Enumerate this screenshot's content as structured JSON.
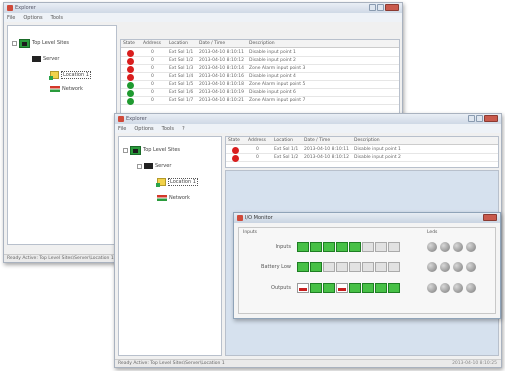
{
  "colors": {
    "status_red": "#d91e1e",
    "status_green": "#1f9a30",
    "io_on": "#47c046",
    "io_fault": "#c81e1e",
    "title_bar": "#cfd9e6",
    "workspace": "#d6e1ee"
  },
  "back_window": {
    "title": "Explorer",
    "menu": [
      "File",
      "Options",
      "Tools"
    ],
    "tree": {
      "root": "Top Level Sites",
      "server": "Server",
      "folder": "Location 1",
      "network": "Network"
    },
    "columns": [
      "State",
      "Address",
      "Location",
      "Date / Time",
      "Description"
    ],
    "rows": [
      {
        "status": "red",
        "address": "0",
        "location": "Ext Sol 1/1",
        "datetime": "2013-04-10 8:10:11",
        "description": "Disable input point 1"
      },
      {
        "status": "red",
        "address": "0",
        "location": "Ext Sol 1/2",
        "datetime": "2013-04-10 8:10:12",
        "description": "Disable input point 2"
      },
      {
        "status": "red",
        "address": "0",
        "location": "Ext Sol 1/3",
        "datetime": "2013-04-10 8:10:14",
        "description": "Zone Alarm input point 3"
      },
      {
        "status": "red",
        "address": "0",
        "location": "Ext Sol 1/4",
        "datetime": "2013-04-10 8:10:16",
        "description": "Disable input point 4"
      },
      {
        "status": "green",
        "address": "0",
        "location": "Ext Sol 1/5",
        "datetime": "2013-04-10 8:10:18",
        "description": "Zone Alarm input point 5"
      },
      {
        "status": "green",
        "address": "0",
        "location": "Ext Sol 1/6",
        "datetime": "2013-04-10 8:10:19",
        "description": "Disable input point 6"
      },
      {
        "status": "green",
        "address": "0",
        "location": "Ext Sol 1/7",
        "datetime": "2013-04-10 8:10:21",
        "description": "Zone Alarm input point 7"
      }
    ],
    "status_text": "Ready Active: Top Level Sites\\Server\\Location 1"
  },
  "front_window": {
    "title": "Explorer",
    "menu": [
      "File",
      "Options",
      "Tools",
      "?"
    ],
    "tree": {
      "root": "Top Level Sites",
      "server": "Server",
      "folder": "Location 1",
      "network": "Network"
    },
    "columns": [
      "State",
      "Address",
      "Location",
      "Date / Time",
      "Description"
    ],
    "rows": [
      {
        "status": "red",
        "address": "0",
        "location": "Ext Sol 1/1",
        "datetime": "2013-04-10 8:10:11",
        "description": "Disable input point 1"
      },
      {
        "status": "red",
        "address": "0",
        "location": "Ext Sol 1/2",
        "datetime": "2013-04-10 8:10:12",
        "description": "Disable input point 2"
      }
    ],
    "status_text": "Ready Active: Top Level Sites\\Server\\Location 1",
    "status_right": "2013-04-10 8:10:25"
  },
  "io_dialog": {
    "title": "I/O Monitor",
    "group_left": "Inputs",
    "group_right": "Leds",
    "rows": [
      {
        "label": "Inputs",
        "cells": [
          "on",
          "on",
          "on",
          "on",
          "on",
          "off",
          "off",
          "off"
        ]
      },
      {
        "label": "Battery Low",
        "cells": [
          "on",
          "on",
          "off",
          "off",
          "off",
          "off",
          "off",
          "off"
        ]
      },
      {
        "label": "Outputs",
        "cells": [
          "fault",
          "on",
          "on",
          "fault",
          "on",
          "on",
          "on",
          "on"
        ]
      }
    ],
    "leds_per_row": 4
  }
}
